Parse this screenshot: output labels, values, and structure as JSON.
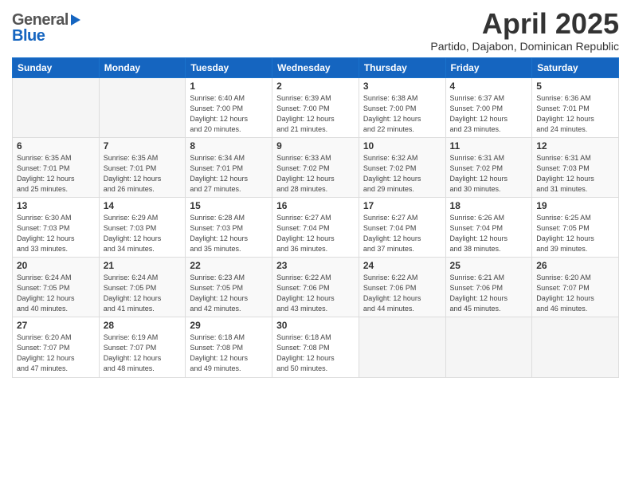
{
  "header": {
    "logo_general": "General",
    "logo_blue": "Blue",
    "month_title": "April 2025",
    "subtitle": "Partido, Dajabon, Dominican Republic"
  },
  "days_of_week": [
    "Sunday",
    "Monday",
    "Tuesday",
    "Wednesday",
    "Thursday",
    "Friday",
    "Saturday"
  ],
  "weeks": [
    [
      {
        "day": "",
        "info": ""
      },
      {
        "day": "",
        "info": ""
      },
      {
        "day": "1",
        "info": "Sunrise: 6:40 AM\nSunset: 7:00 PM\nDaylight: 12 hours\nand 20 minutes."
      },
      {
        "day": "2",
        "info": "Sunrise: 6:39 AM\nSunset: 7:00 PM\nDaylight: 12 hours\nand 21 minutes."
      },
      {
        "day": "3",
        "info": "Sunrise: 6:38 AM\nSunset: 7:00 PM\nDaylight: 12 hours\nand 22 minutes."
      },
      {
        "day": "4",
        "info": "Sunrise: 6:37 AM\nSunset: 7:00 PM\nDaylight: 12 hours\nand 23 minutes."
      },
      {
        "day": "5",
        "info": "Sunrise: 6:36 AM\nSunset: 7:01 PM\nDaylight: 12 hours\nand 24 minutes."
      }
    ],
    [
      {
        "day": "6",
        "info": "Sunrise: 6:35 AM\nSunset: 7:01 PM\nDaylight: 12 hours\nand 25 minutes."
      },
      {
        "day": "7",
        "info": "Sunrise: 6:35 AM\nSunset: 7:01 PM\nDaylight: 12 hours\nand 26 minutes."
      },
      {
        "day": "8",
        "info": "Sunrise: 6:34 AM\nSunset: 7:01 PM\nDaylight: 12 hours\nand 27 minutes."
      },
      {
        "day": "9",
        "info": "Sunrise: 6:33 AM\nSunset: 7:02 PM\nDaylight: 12 hours\nand 28 minutes."
      },
      {
        "day": "10",
        "info": "Sunrise: 6:32 AM\nSunset: 7:02 PM\nDaylight: 12 hours\nand 29 minutes."
      },
      {
        "day": "11",
        "info": "Sunrise: 6:31 AM\nSunset: 7:02 PM\nDaylight: 12 hours\nand 30 minutes."
      },
      {
        "day": "12",
        "info": "Sunrise: 6:31 AM\nSunset: 7:03 PM\nDaylight: 12 hours\nand 31 minutes."
      }
    ],
    [
      {
        "day": "13",
        "info": "Sunrise: 6:30 AM\nSunset: 7:03 PM\nDaylight: 12 hours\nand 33 minutes."
      },
      {
        "day": "14",
        "info": "Sunrise: 6:29 AM\nSunset: 7:03 PM\nDaylight: 12 hours\nand 34 minutes."
      },
      {
        "day": "15",
        "info": "Sunrise: 6:28 AM\nSunset: 7:03 PM\nDaylight: 12 hours\nand 35 minutes."
      },
      {
        "day": "16",
        "info": "Sunrise: 6:27 AM\nSunset: 7:04 PM\nDaylight: 12 hours\nand 36 minutes."
      },
      {
        "day": "17",
        "info": "Sunrise: 6:27 AM\nSunset: 7:04 PM\nDaylight: 12 hours\nand 37 minutes."
      },
      {
        "day": "18",
        "info": "Sunrise: 6:26 AM\nSunset: 7:04 PM\nDaylight: 12 hours\nand 38 minutes."
      },
      {
        "day": "19",
        "info": "Sunrise: 6:25 AM\nSunset: 7:05 PM\nDaylight: 12 hours\nand 39 minutes."
      }
    ],
    [
      {
        "day": "20",
        "info": "Sunrise: 6:24 AM\nSunset: 7:05 PM\nDaylight: 12 hours\nand 40 minutes."
      },
      {
        "day": "21",
        "info": "Sunrise: 6:24 AM\nSunset: 7:05 PM\nDaylight: 12 hours\nand 41 minutes."
      },
      {
        "day": "22",
        "info": "Sunrise: 6:23 AM\nSunset: 7:05 PM\nDaylight: 12 hours\nand 42 minutes."
      },
      {
        "day": "23",
        "info": "Sunrise: 6:22 AM\nSunset: 7:06 PM\nDaylight: 12 hours\nand 43 minutes."
      },
      {
        "day": "24",
        "info": "Sunrise: 6:22 AM\nSunset: 7:06 PM\nDaylight: 12 hours\nand 44 minutes."
      },
      {
        "day": "25",
        "info": "Sunrise: 6:21 AM\nSunset: 7:06 PM\nDaylight: 12 hours\nand 45 minutes."
      },
      {
        "day": "26",
        "info": "Sunrise: 6:20 AM\nSunset: 7:07 PM\nDaylight: 12 hours\nand 46 minutes."
      }
    ],
    [
      {
        "day": "27",
        "info": "Sunrise: 6:20 AM\nSunset: 7:07 PM\nDaylight: 12 hours\nand 47 minutes."
      },
      {
        "day": "28",
        "info": "Sunrise: 6:19 AM\nSunset: 7:07 PM\nDaylight: 12 hours\nand 48 minutes."
      },
      {
        "day": "29",
        "info": "Sunrise: 6:18 AM\nSunset: 7:08 PM\nDaylight: 12 hours\nand 49 minutes."
      },
      {
        "day": "30",
        "info": "Sunrise: 6:18 AM\nSunset: 7:08 PM\nDaylight: 12 hours\nand 50 minutes."
      },
      {
        "day": "",
        "info": ""
      },
      {
        "day": "",
        "info": ""
      },
      {
        "day": "",
        "info": ""
      }
    ]
  ]
}
